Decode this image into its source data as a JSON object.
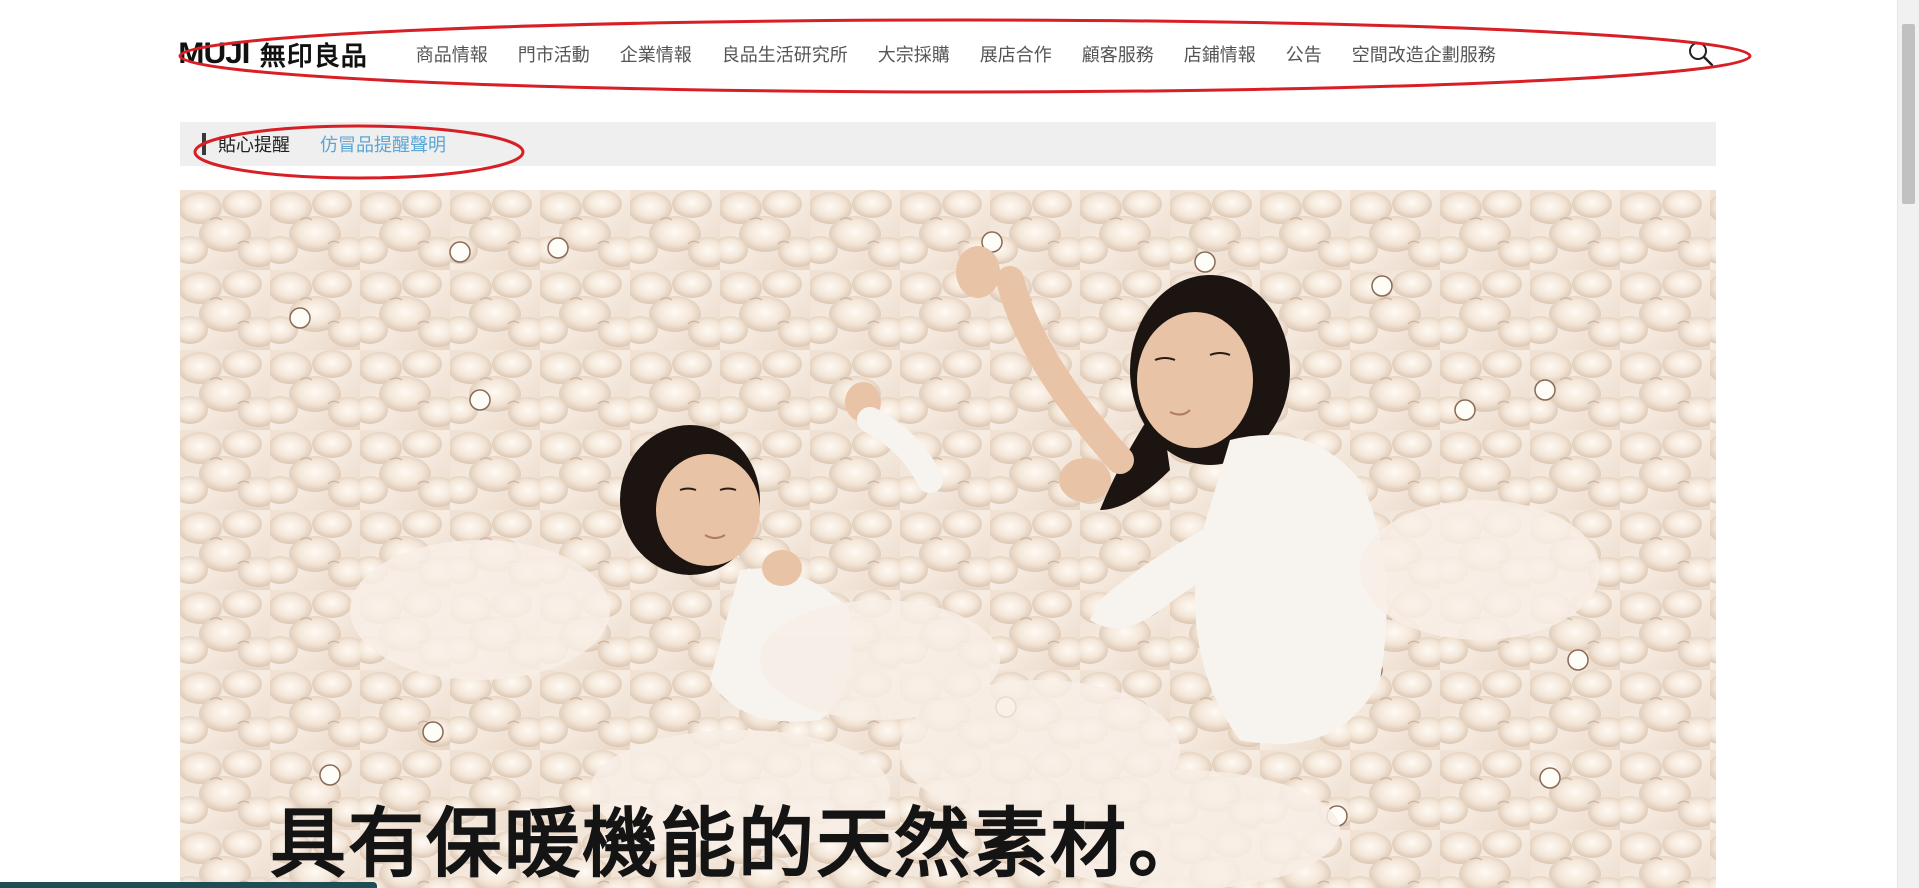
{
  "header": {
    "logo_latin": "MUJI",
    "logo_cjk": "無印良品",
    "nav": [
      "商品情報",
      "門市活動",
      "企業情報",
      "良品生活研究所",
      "大宗採購",
      "展店合作",
      "顧客服務",
      "店鋪情報",
      "公告",
      "空間改造企劃服務"
    ],
    "search_icon": "search-icon"
  },
  "notice": {
    "label": "貼心提醒",
    "link": "仿冒品提醒聲明"
  },
  "hero": {
    "caption": "具有保暖機能的天然素材。"
  },
  "colors": {
    "annotation": "#d81f26",
    "link": "#5aa6d6",
    "notice_bg": "#efefef",
    "nav_text": "#555555"
  }
}
